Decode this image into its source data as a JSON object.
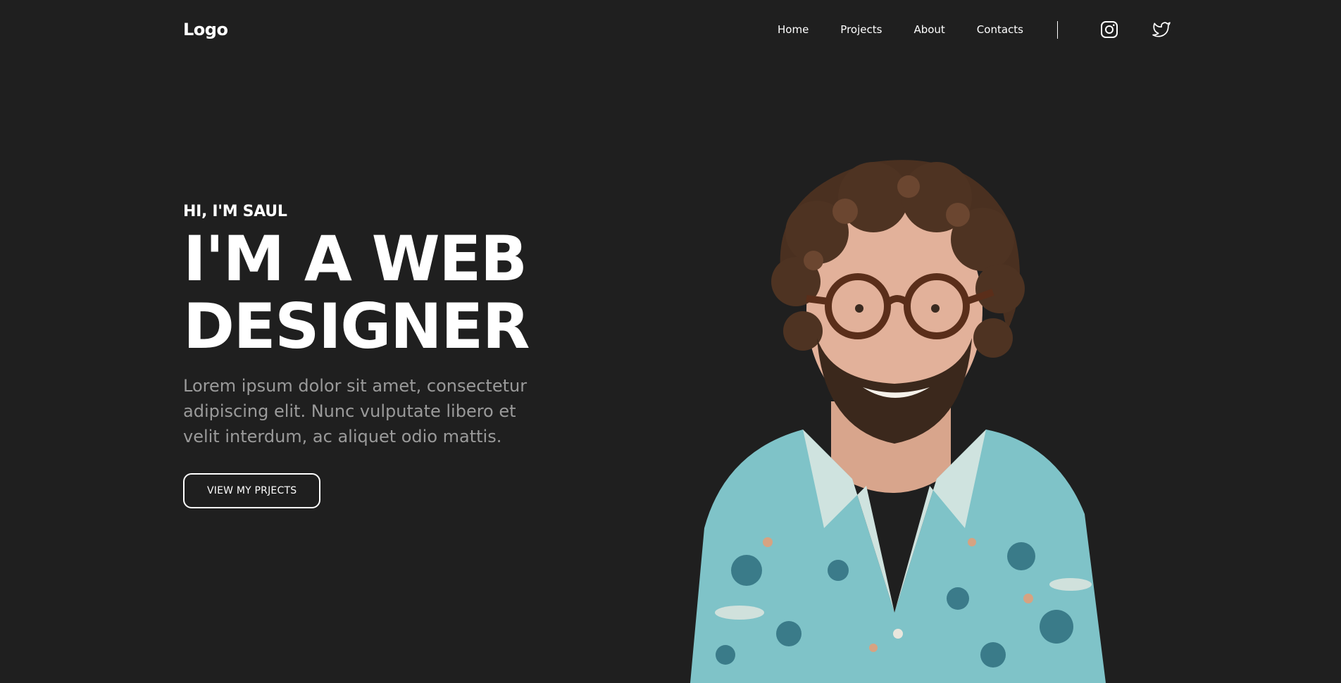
{
  "header": {
    "logo": "Logo",
    "nav": [
      {
        "label": "Home"
      },
      {
        "label": "Projects"
      },
      {
        "label": "About"
      },
      {
        "label": "Contacts"
      }
    ],
    "social": [
      {
        "icon": "instagram-icon"
      },
      {
        "icon": "twitter-icon"
      }
    ]
  },
  "hero": {
    "greeting": "HI, I'M SAUL",
    "headline_line1": "I'M A WEB",
    "headline_line2": "DESIGNER",
    "description": "Lorem ipsum dolor sit amet, consectetur adipiscing elit. Nunc vulputate libero et velit interdum, ac aliquet odio mattis.",
    "cta_label": "VIEW MY PRJECTS"
  },
  "colors": {
    "background": "#1f1f1f",
    "text": "#ffffff",
    "muted_text": "#9a9a9a",
    "shirt": "#7fc3c8"
  }
}
